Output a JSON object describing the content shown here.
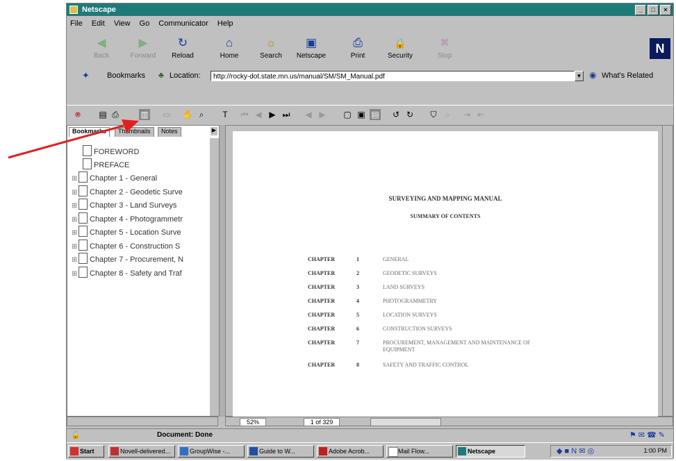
{
  "window": {
    "title": "Netscape",
    "controls": [
      "_",
      "□",
      "×"
    ]
  },
  "menu": [
    "File",
    "Edit",
    "View",
    "Go",
    "Communicator",
    "Help"
  ],
  "nav_toolbar": [
    {
      "label": "Back",
      "icon": "back-arrow-icon",
      "glyph": "◀",
      "color": "#2a8a2a",
      "enabled": false
    },
    {
      "label": "Forward",
      "icon": "forward-arrow-icon",
      "glyph": "▶",
      "color": "#2a8a2a",
      "enabled": false
    },
    {
      "label": "Reload",
      "icon": "reload-icon",
      "glyph": "↻",
      "color": "#1a3a9a",
      "enabled": true
    },
    {
      "label": "Home",
      "icon": "home-icon",
      "glyph": "⌂",
      "color": "#1a3a9a",
      "enabled": true
    },
    {
      "label": "Search",
      "icon": "search-icon",
      "glyph": "☼",
      "color": "#b08a20",
      "enabled": true
    },
    {
      "label": "Netscape",
      "icon": "netscape-icon",
      "glyph": "▣",
      "color": "#1a3a9a",
      "enabled": true
    },
    {
      "label": "Print",
      "icon": "print-icon",
      "glyph": "⎙",
      "color": "#1a3a9a",
      "enabled": true
    },
    {
      "label": "Security",
      "icon": "lock-icon",
      "glyph": "🔒",
      "color": "#8a2a2a",
      "enabled": true
    },
    {
      "label": "Stop",
      "icon": "stop-icon",
      "glyph": "✖",
      "color": "#8a6a8a",
      "enabled": false
    }
  ],
  "location": {
    "bookmarks_label": "Bookmarks",
    "location_label": "Location:",
    "url": "http://rocky-dot.state.mn.us/manual/SM/SM_Manual.pdf",
    "whats_related": "What's Related"
  },
  "bookmark_tabs": [
    "Bookmarks",
    "Thumbnails",
    "Notes"
  ],
  "tree": [
    {
      "label": "FOREWORD",
      "expandable": false
    },
    {
      "label": "PREFACE",
      "expandable": false
    },
    {
      "label": "Chapter 1 - General",
      "expandable": true
    },
    {
      "label": "Chapter 2 - Geodetic Surve",
      "expandable": true
    },
    {
      "label": "Chapter 3 - Land Surveys",
      "expandable": true
    },
    {
      "label": "Chapter 4 - Photogrammetr",
      "expandable": true
    },
    {
      "label": "Chapter 5 - Location Surve",
      "expandable": true
    },
    {
      "label": "Chapter 6 - Construction S",
      "expandable": true
    },
    {
      "label": "Chapter 7 - Procurement, N",
      "expandable": true
    },
    {
      "label": "Chapter 8 - Safety and Traf",
      "expandable": true
    }
  ],
  "document": {
    "title": "SURVEYING AND MAPPING MANUAL",
    "subtitle": "SUMMARY OF CONTENTS",
    "chapter_label": "CHAPTER",
    "chapters": [
      {
        "num": "1",
        "name": "GENERAL"
      },
      {
        "num": "2",
        "name": "GEODETIC SURVEYS"
      },
      {
        "num": "3",
        "name": "LAND SURVEYS"
      },
      {
        "num": "4",
        "name": "PHOTOGRAMMETRY"
      },
      {
        "num": "5",
        "name": "LOCATION SURVEYS"
      },
      {
        "num": "6",
        "name": "CONSTRUCTION SURVEYS"
      },
      {
        "num": "7",
        "name": "PROCUREMENT, MANAGEMENT AND MAINTENANCE OF EQUIPMENT"
      },
      {
        "num": "8",
        "name": "SAFETY AND TRAFFIC CONTROL"
      }
    ]
  },
  "doc_status": {
    "zoom": "52%",
    "page": "1 of 329"
  },
  "status": {
    "text": "Document: Done"
  },
  "taskbar": {
    "start": "Start",
    "buttons": [
      "Novell-delivered...",
      "GroupWise -...",
      "Guide to W...",
      "Adobe Acrob...",
      "Mail Flow...",
      "Netscape"
    ],
    "active": "Netscape",
    "clock": "1:00 PM"
  },
  "colors": {
    "title_bar": "#1f7a7a",
    "arrow": "#e02020"
  }
}
